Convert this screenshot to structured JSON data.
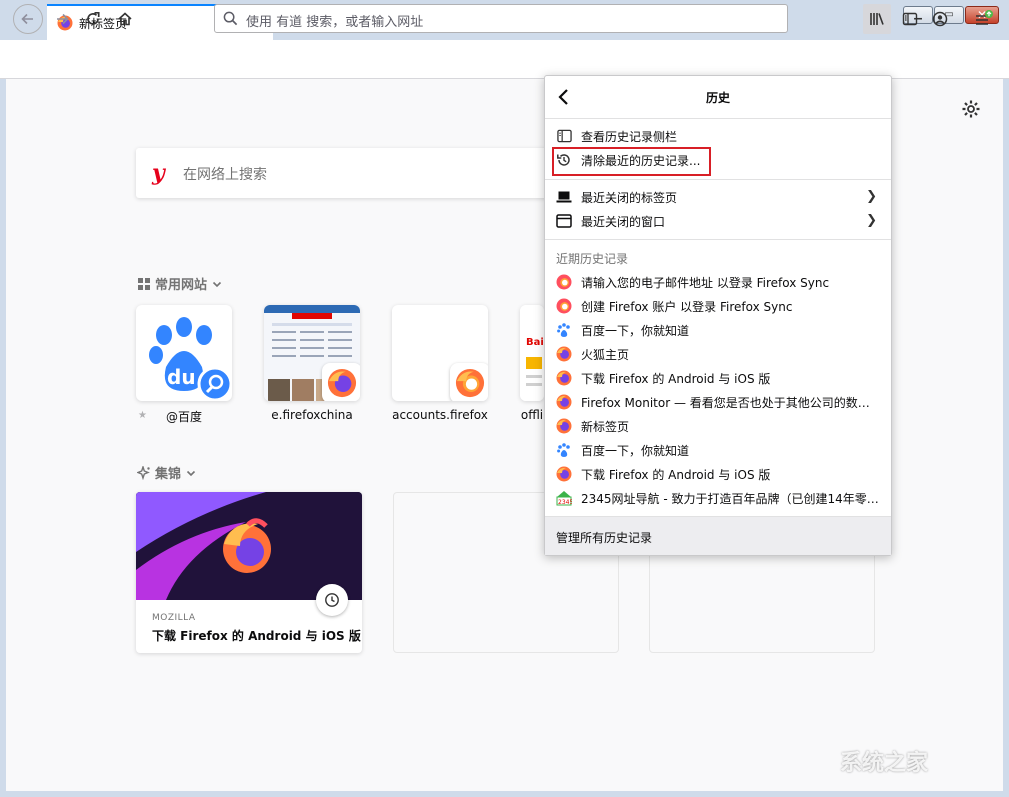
{
  "tab": {
    "title": "新标签页",
    "close_glyph": "✕",
    "new_tab_glyph": "+"
  },
  "window_controls": {
    "minimize": "▁",
    "maximize": "▭",
    "close": "✕"
  },
  "urlbar": {
    "placeholder": "使用 有道 搜索，或者输入网址"
  },
  "search": {
    "logo": "y",
    "placeholder": "在网络上搜索"
  },
  "topsites": {
    "title": "常用网站",
    "items": [
      {
        "label": "@百度"
      },
      {
        "label": "e.firefoxchina"
      },
      {
        "label": "accounts.firefox"
      },
      {
        "label": "offli"
      }
    ]
  },
  "highlights": {
    "title": "集锦",
    "card": {
      "source": "MOZILLA",
      "title": "下载 Firefox 的 Android 与 iOS 版"
    }
  },
  "history_panel": {
    "title": "历史",
    "actions": [
      {
        "label": "查看历史记录侧栏",
        "icon": "sidebar-icon"
      },
      {
        "label": "清除最近的历史记录...",
        "icon": "history-clear-icon"
      }
    ],
    "submenus": [
      {
        "label": "最近关闭的标签页",
        "icon": "laptop-icon"
      },
      {
        "label": "最近关闭的窗口",
        "icon": "window-icon"
      }
    ],
    "recent_title": "近期历史记录",
    "recent": [
      {
        "label": "请输入您的电子邮件地址 以登录 Firefox Sync",
        "icon": "firefox-account-icon"
      },
      {
        "label": "创建 Firefox 账户 以登录 Firefox Sync",
        "icon": "firefox-account-icon"
      },
      {
        "label": "百度一下，你就知道",
        "icon": "baidu-paw-icon"
      },
      {
        "label": "火狐主页",
        "icon": "firefox-icon"
      },
      {
        "label": "下载 Firefox 的 Android 与 iOS 版",
        "icon": "firefox-icon"
      },
      {
        "label": "Firefox Monitor — 看看您是否也处于其他公司的数据...",
        "icon": "firefox-icon"
      },
      {
        "label": "新标签页",
        "icon": "firefox-icon"
      },
      {
        "label": "百度一下，你就知道",
        "icon": "baidu-paw-icon"
      },
      {
        "label": "下载 Firefox 的 Android 与 iOS 版",
        "icon": "firefox-icon"
      },
      {
        "label": "2345网址导航 - 致力于打造百年品牌（已创建14年零3...",
        "icon": "2345-icon"
      }
    ],
    "footer": "管理所有历史记录"
  },
  "watermark": "系统之家",
  "colors": {
    "accent": "#0a84ff",
    "highlight_border": "#d81f26",
    "firefox_orange": "#ff7139"
  }
}
